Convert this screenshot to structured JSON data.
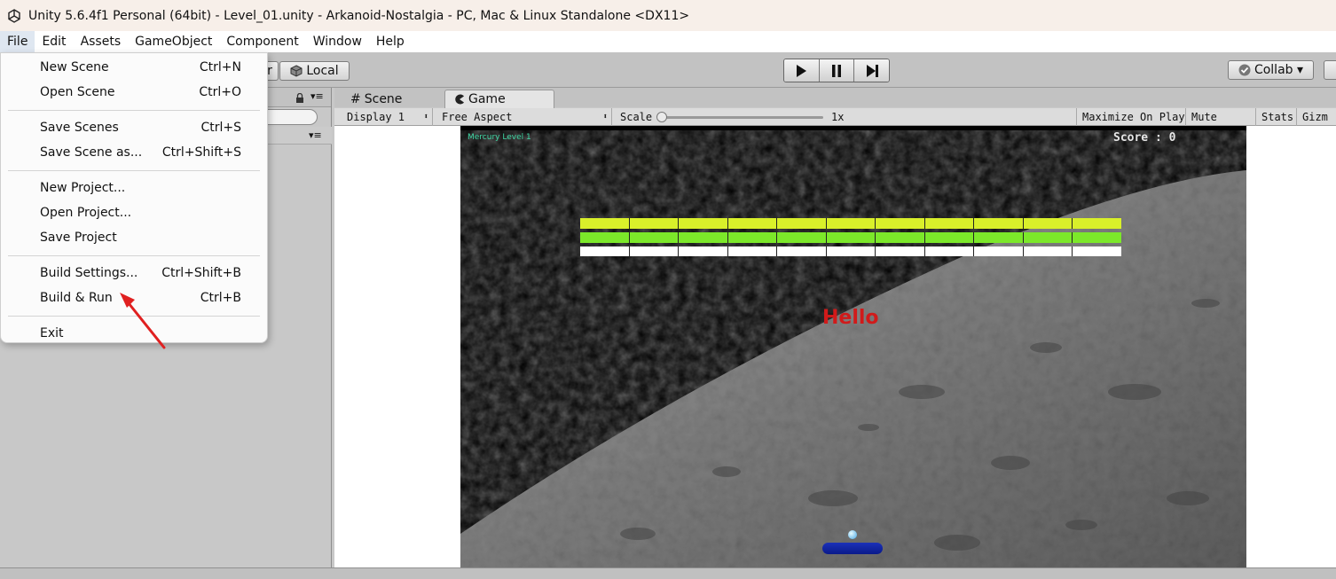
{
  "window": {
    "title": "Unity 5.6.4f1 Personal (64bit) - Level_01.unity - Arkanoid-Nostalgia - PC, Mac & Linux Standalone <DX11>"
  },
  "menubar": {
    "items": [
      "File",
      "Edit",
      "Assets",
      "GameObject",
      "Component",
      "Window",
      "Help"
    ]
  },
  "file_menu": {
    "groups": [
      [
        {
          "label": "New Scene",
          "shortcut": "Ctrl+N"
        },
        {
          "label": "Open Scene",
          "shortcut": "Ctrl+O"
        }
      ],
      [
        {
          "label": "Save Scenes",
          "shortcut": "Ctrl+S"
        },
        {
          "label": "Save Scene as...",
          "shortcut": "Ctrl+Shift+S"
        }
      ],
      [
        {
          "label": "New Project...",
          "shortcut": ""
        },
        {
          "label": "Open Project...",
          "shortcut": ""
        },
        {
          "label": "Save Project",
          "shortcut": ""
        }
      ],
      [
        {
          "label": "Build Settings...",
          "shortcut": "Ctrl+Shift+B"
        },
        {
          "label": "Build & Run",
          "shortcut": "Ctrl+B"
        }
      ],
      [
        {
          "label": "Exit",
          "shortcut": ""
        }
      ]
    ]
  },
  "toolbar": {
    "pivot_partial": "r",
    "local_label": "Local",
    "collab_label": "Collab ▾"
  },
  "tabs": {
    "scene": "Scene",
    "game": "Game"
  },
  "game_toolbar": {
    "display": "Display 1",
    "aspect": "Free Aspect",
    "scale_label": "Scale",
    "scale_value": "1x",
    "maximize": "Maximize On Play",
    "mute": "Mute Audio",
    "stats": "Stats",
    "gizmos": "Gizm"
  },
  "game": {
    "level_label": "Mercury Level 1",
    "score": "Score : 0",
    "hello": "Hello",
    "brick_rows": [
      {
        "color": "#d9f02a",
        "count": 11
      },
      {
        "color": "#7ce82a",
        "count": 11
      },
      {
        "color": "#ffffff",
        "count": 11
      }
    ]
  },
  "colors": {
    "annotation_arrow": "#e02020",
    "hello_text": "#d11a1a",
    "level_text": "#41d9a6"
  }
}
